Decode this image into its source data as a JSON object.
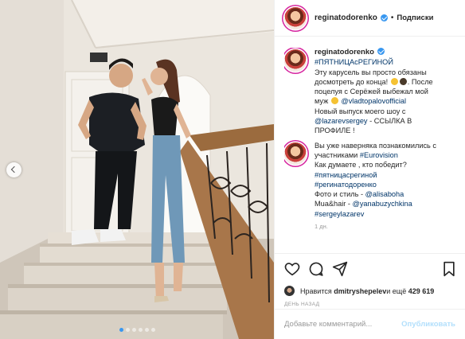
{
  "post": {
    "username": "reginatodorenko",
    "follow_label": "Подписки",
    "separator": "•",
    "caption": {
      "username": "reginatodorenko",
      "hashtag1": "#ПЯТНИЦАсРЕГИНОЙ",
      "line2": "Эту карусель вы просто обязаны",
      "line3_a": "досмотреть до конца!",
      "line3_b": ". После",
      "line4": "поцелуя с Серёжей выбежал мой",
      "line5_a": "муж",
      "line5_link": "@vladtopalovofficial",
      "line6": "Новый выпуск моего шоу с",
      "line7_link": "@lazarevsergey",
      "line7_b": " - ССЫЛКА В",
      "line8": "ПРОФИЛЕ !"
    },
    "comment": {
      "line1": "Вы уже наверняка познакомились с",
      "line2_a": "участниками ",
      "line2_link": "#Eurovision",
      "line3": "Как думаете , кто победит?",
      "line4_link": "#пятницасрегиной",
      "line5_link": "#регинатодоренко",
      "line6_a": "Фото и стиль - ",
      "line6_link": "@alisaboha",
      "line7_a": "Mua&hair - ",
      "line7_link": "@yanabuzychkina",
      "line8_link": "#sergeylazarev",
      "time": "1 дн."
    },
    "likes": {
      "prefix": "Нравится ",
      "user": "dmitryshepelev",
      "middle": " и ещё ",
      "count": "429 619"
    },
    "posted": "ДЕНЬ НАЗАД",
    "add_comment_placeholder": "Добавьте комментарий...",
    "publish_label": "Опубликовать"
  },
  "carousel": {
    "slides": 6,
    "active_index": 0
  },
  "colors": {
    "link": "#003569",
    "verified": "#3897f0",
    "publish_disabled": "#b2dffc",
    "meta": "#999999"
  },
  "icons": [
    "heart-icon",
    "comment-icon",
    "share-icon",
    "bookmark-icon",
    "chevron-left-icon",
    "verified-badge-icon"
  ]
}
